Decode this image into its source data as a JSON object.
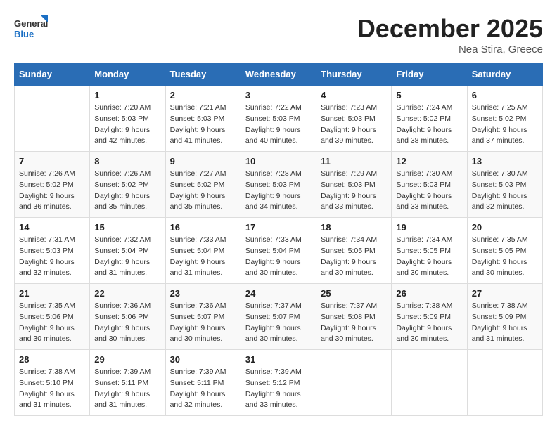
{
  "logo": {
    "general": "General",
    "blue": "Blue"
  },
  "title": "December 2025",
  "location": "Nea Stira, Greece",
  "weekdays": [
    "Sunday",
    "Monday",
    "Tuesday",
    "Wednesday",
    "Thursday",
    "Friday",
    "Saturday"
  ],
  "weeks": [
    [
      {
        "day": "",
        "sunrise": "",
        "sunset": "",
        "daylight": ""
      },
      {
        "day": "1",
        "sunrise": "Sunrise: 7:20 AM",
        "sunset": "Sunset: 5:03 PM",
        "daylight": "Daylight: 9 hours and 42 minutes."
      },
      {
        "day": "2",
        "sunrise": "Sunrise: 7:21 AM",
        "sunset": "Sunset: 5:03 PM",
        "daylight": "Daylight: 9 hours and 41 minutes."
      },
      {
        "day": "3",
        "sunrise": "Sunrise: 7:22 AM",
        "sunset": "Sunset: 5:03 PM",
        "daylight": "Daylight: 9 hours and 40 minutes."
      },
      {
        "day": "4",
        "sunrise": "Sunrise: 7:23 AM",
        "sunset": "Sunset: 5:03 PM",
        "daylight": "Daylight: 9 hours and 39 minutes."
      },
      {
        "day": "5",
        "sunrise": "Sunrise: 7:24 AM",
        "sunset": "Sunset: 5:02 PM",
        "daylight": "Daylight: 9 hours and 38 minutes."
      },
      {
        "day": "6",
        "sunrise": "Sunrise: 7:25 AM",
        "sunset": "Sunset: 5:02 PM",
        "daylight": "Daylight: 9 hours and 37 minutes."
      }
    ],
    [
      {
        "day": "7",
        "sunrise": "Sunrise: 7:26 AM",
        "sunset": "Sunset: 5:02 PM",
        "daylight": "Daylight: 9 hours and 36 minutes."
      },
      {
        "day": "8",
        "sunrise": "Sunrise: 7:26 AM",
        "sunset": "Sunset: 5:02 PM",
        "daylight": "Daylight: 9 hours and 35 minutes."
      },
      {
        "day": "9",
        "sunrise": "Sunrise: 7:27 AM",
        "sunset": "Sunset: 5:02 PM",
        "daylight": "Daylight: 9 hours and 35 minutes."
      },
      {
        "day": "10",
        "sunrise": "Sunrise: 7:28 AM",
        "sunset": "Sunset: 5:03 PM",
        "daylight": "Daylight: 9 hours and 34 minutes."
      },
      {
        "day": "11",
        "sunrise": "Sunrise: 7:29 AM",
        "sunset": "Sunset: 5:03 PM",
        "daylight": "Daylight: 9 hours and 33 minutes."
      },
      {
        "day": "12",
        "sunrise": "Sunrise: 7:30 AM",
        "sunset": "Sunset: 5:03 PM",
        "daylight": "Daylight: 9 hours and 33 minutes."
      },
      {
        "day": "13",
        "sunrise": "Sunrise: 7:30 AM",
        "sunset": "Sunset: 5:03 PM",
        "daylight": "Daylight: 9 hours and 32 minutes."
      }
    ],
    [
      {
        "day": "14",
        "sunrise": "Sunrise: 7:31 AM",
        "sunset": "Sunset: 5:03 PM",
        "daylight": "Daylight: 9 hours and 32 minutes."
      },
      {
        "day": "15",
        "sunrise": "Sunrise: 7:32 AM",
        "sunset": "Sunset: 5:04 PM",
        "daylight": "Daylight: 9 hours and 31 minutes."
      },
      {
        "day": "16",
        "sunrise": "Sunrise: 7:33 AM",
        "sunset": "Sunset: 5:04 PM",
        "daylight": "Daylight: 9 hours and 31 minutes."
      },
      {
        "day": "17",
        "sunrise": "Sunrise: 7:33 AM",
        "sunset": "Sunset: 5:04 PM",
        "daylight": "Daylight: 9 hours and 30 minutes."
      },
      {
        "day": "18",
        "sunrise": "Sunrise: 7:34 AM",
        "sunset": "Sunset: 5:05 PM",
        "daylight": "Daylight: 9 hours and 30 minutes."
      },
      {
        "day": "19",
        "sunrise": "Sunrise: 7:34 AM",
        "sunset": "Sunset: 5:05 PM",
        "daylight": "Daylight: 9 hours and 30 minutes."
      },
      {
        "day": "20",
        "sunrise": "Sunrise: 7:35 AM",
        "sunset": "Sunset: 5:05 PM",
        "daylight": "Daylight: 9 hours and 30 minutes."
      }
    ],
    [
      {
        "day": "21",
        "sunrise": "Sunrise: 7:35 AM",
        "sunset": "Sunset: 5:06 PM",
        "daylight": "Daylight: 9 hours and 30 minutes."
      },
      {
        "day": "22",
        "sunrise": "Sunrise: 7:36 AM",
        "sunset": "Sunset: 5:06 PM",
        "daylight": "Daylight: 9 hours and 30 minutes."
      },
      {
        "day": "23",
        "sunrise": "Sunrise: 7:36 AM",
        "sunset": "Sunset: 5:07 PM",
        "daylight": "Daylight: 9 hours and 30 minutes."
      },
      {
        "day": "24",
        "sunrise": "Sunrise: 7:37 AM",
        "sunset": "Sunset: 5:07 PM",
        "daylight": "Daylight: 9 hours and 30 minutes."
      },
      {
        "day": "25",
        "sunrise": "Sunrise: 7:37 AM",
        "sunset": "Sunset: 5:08 PM",
        "daylight": "Daylight: 9 hours and 30 minutes."
      },
      {
        "day": "26",
        "sunrise": "Sunrise: 7:38 AM",
        "sunset": "Sunset: 5:09 PM",
        "daylight": "Daylight: 9 hours and 30 minutes."
      },
      {
        "day": "27",
        "sunrise": "Sunrise: 7:38 AM",
        "sunset": "Sunset: 5:09 PM",
        "daylight": "Daylight: 9 hours and 31 minutes."
      }
    ],
    [
      {
        "day": "28",
        "sunrise": "Sunrise: 7:38 AM",
        "sunset": "Sunset: 5:10 PM",
        "daylight": "Daylight: 9 hours and 31 minutes."
      },
      {
        "day": "29",
        "sunrise": "Sunrise: 7:39 AM",
        "sunset": "Sunset: 5:11 PM",
        "daylight": "Daylight: 9 hours and 31 minutes."
      },
      {
        "day": "30",
        "sunrise": "Sunrise: 7:39 AM",
        "sunset": "Sunset: 5:11 PM",
        "daylight": "Daylight: 9 hours and 32 minutes."
      },
      {
        "day": "31",
        "sunrise": "Sunrise: 7:39 AM",
        "sunset": "Sunset: 5:12 PM",
        "daylight": "Daylight: 9 hours and 33 minutes."
      },
      {
        "day": "",
        "sunrise": "",
        "sunset": "",
        "daylight": ""
      },
      {
        "day": "",
        "sunrise": "",
        "sunset": "",
        "daylight": ""
      },
      {
        "day": "",
        "sunrise": "",
        "sunset": "",
        "daylight": ""
      }
    ]
  ]
}
